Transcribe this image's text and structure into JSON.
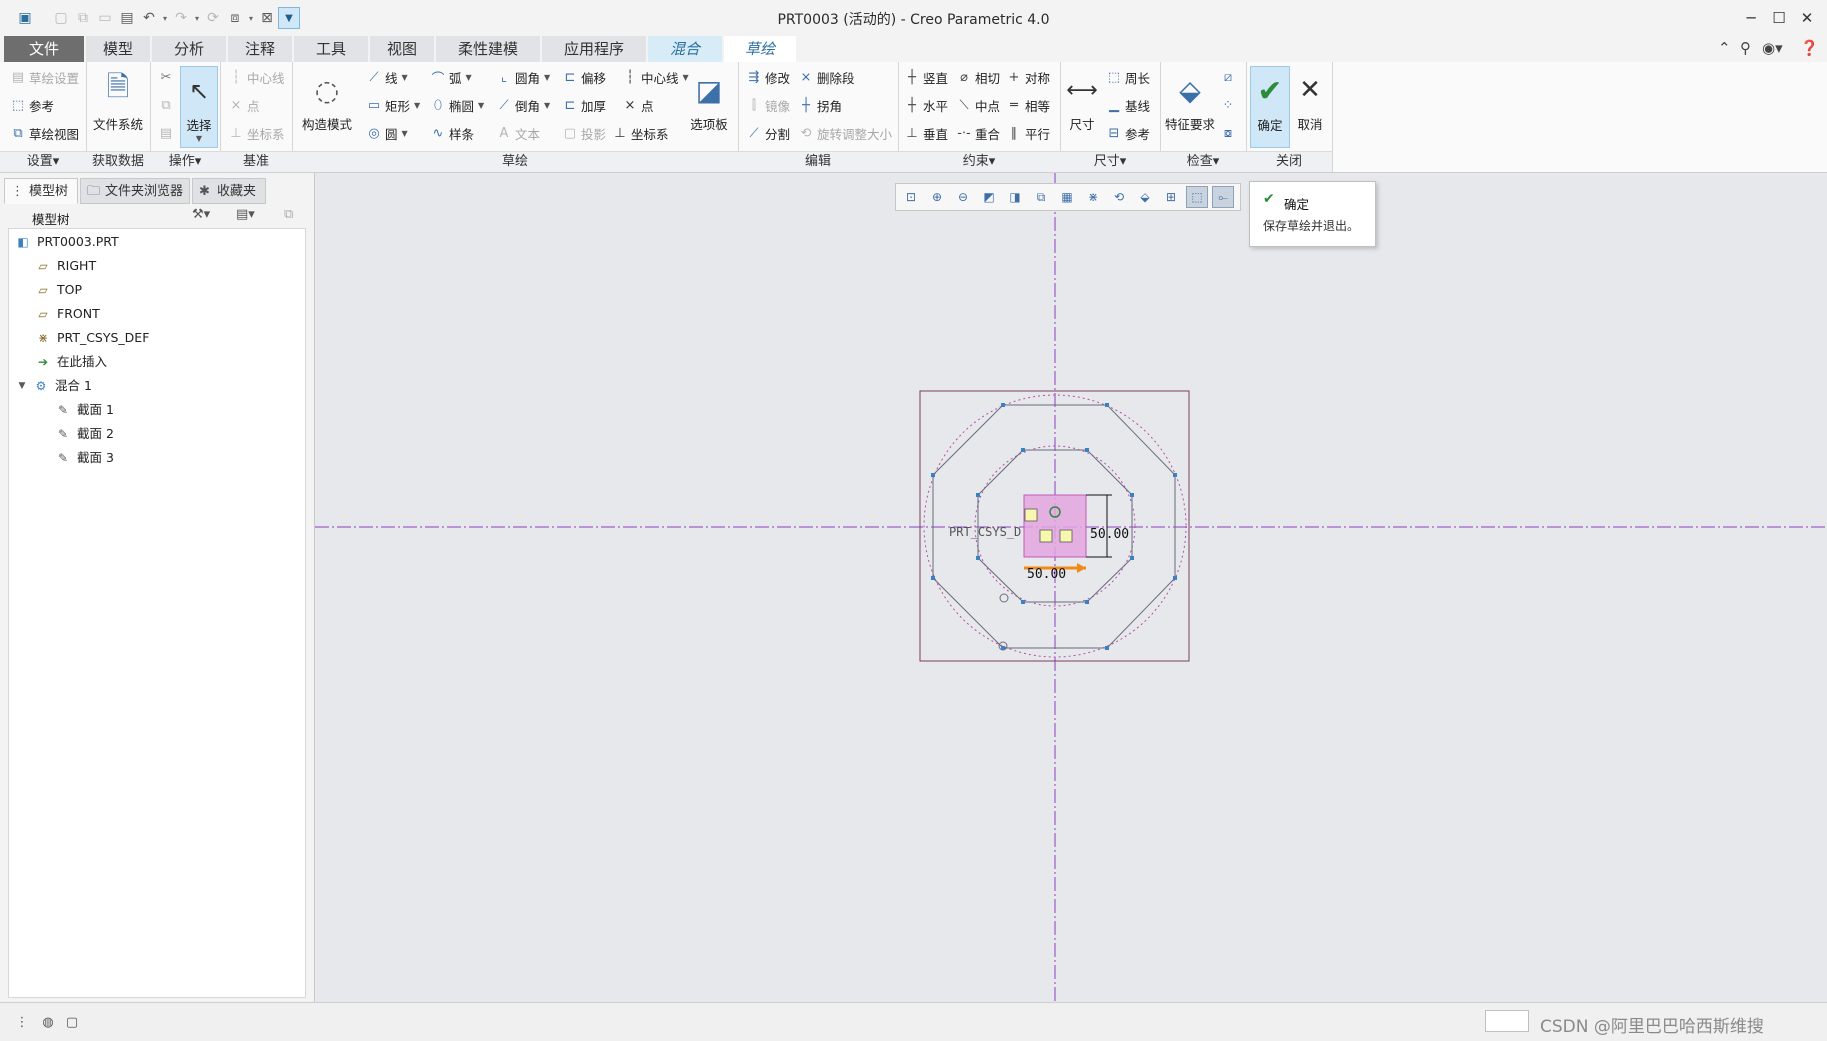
{
  "window": {
    "title": "PRT0003 (活动的) - Creo Parametric 4.0",
    "controls": {
      "minimize": "─",
      "maximize": "☐",
      "close": "✕"
    }
  },
  "tabs": [
    "文件",
    "模型",
    "分析",
    "注释",
    "工具",
    "视图",
    "柔性建模",
    "应用程序",
    "混合",
    "草绘"
  ],
  "ribbon": {
    "groups": {
      "setup": {
        "label": "设置▾",
        "items": [
          "草绘设置",
          "参考",
          "草绘视图"
        ]
      },
      "get_data": {
        "label": "获取数据",
        "file_system": "文件系统"
      },
      "operations": {
        "label": "操作▾",
        "select": "选择"
      },
      "datum": {
        "label": "基准",
        "items": [
          "中心线",
          "点",
          "坐标系"
        ]
      },
      "sketching": {
        "label": "草绘",
        "construction_mode": "构造模式",
        "items": [
          "线",
          "弧",
          "圆角",
          "偏移",
          "中心线",
          "矩形",
          "椭圆",
          "倒角",
          "加厚",
          "点",
          "圆",
          "样条",
          "文本",
          "投影",
          "坐标系"
        ],
        "palette": "选项板"
      },
      "editing": {
        "label": "编辑",
        "items": [
          "修改",
          "删除段",
          "镜像",
          "拐角",
          "分割",
          "旋转调整大小"
        ]
      },
      "constrain": {
        "label": "约束▾",
        "items": [
          "竖直",
          "相切",
          "对称",
          "水平",
          "中点",
          "相等",
          "垂直",
          "重合",
          "平行"
        ]
      },
      "dimension": {
        "label": "尺寸▾",
        "dimension": "尺寸",
        "items": [
          "周长",
          "基线",
          "参考"
        ]
      },
      "inspect": {
        "label": "检查▾",
        "feature_requirements": "特征要求"
      },
      "close": {
        "label": "关闭",
        "ok": "确定",
        "cancel": "取消"
      }
    }
  },
  "left_panel": {
    "tabs": [
      "模型树",
      "文件夹浏览器",
      "收藏夹"
    ],
    "header": "模型树",
    "tree": [
      {
        "label": "PRT0003.PRT",
        "icon": "part-icon",
        "level": 0
      },
      {
        "label": "RIGHT",
        "icon": "datum-plane-icon",
        "level": 1
      },
      {
        "label": "TOP",
        "icon": "datum-plane-icon",
        "level": 1
      },
      {
        "label": "FRONT",
        "icon": "datum-plane-icon",
        "level": 1
      },
      {
        "label": "PRT_CSYS_DEF",
        "icon": "csys-icon",
        "level": 1
      },
      {
        "label": "在此插入",
        "icon": "insert-arrow-icon",
        "level": 1
      },
      {
        "label": "混合 1",
        "icon": "blend-feature-icon",
        "level": 1
      },
      {
        "label": "截面 1",
        "icon": "sketch-section-icon",
        "level": 2
      },
      {
        "label": "截面 2",
        "icon": "sketch-section-icon",
        "level": 2
      },
      {
        "label": "截面 3",
        "icon": "sketch-section-icon",
        "level": 2
      }
    ]
  },
  "tooltip": {
    "title": "确定",
    "description": "保存草绘并退出。"
  },
  "sketch": {
    "csys_label": "PRT_CSYS_D",
    "dim_vertical": "50.00",
    "dim_horizontal": "50.00",
    "colors": {
      "centerline": "#8a3fbf",
      "geometry": "#6b6b7a",
      "frame": "#7a3f5a",
      "highlight": "#e3a6e0",
      "dimension_arrow": "#f08a18"
    }
  },
  "status": {
    "watermark": "CSDN @阿里巴巴哈西斯维搜"
  }
}
